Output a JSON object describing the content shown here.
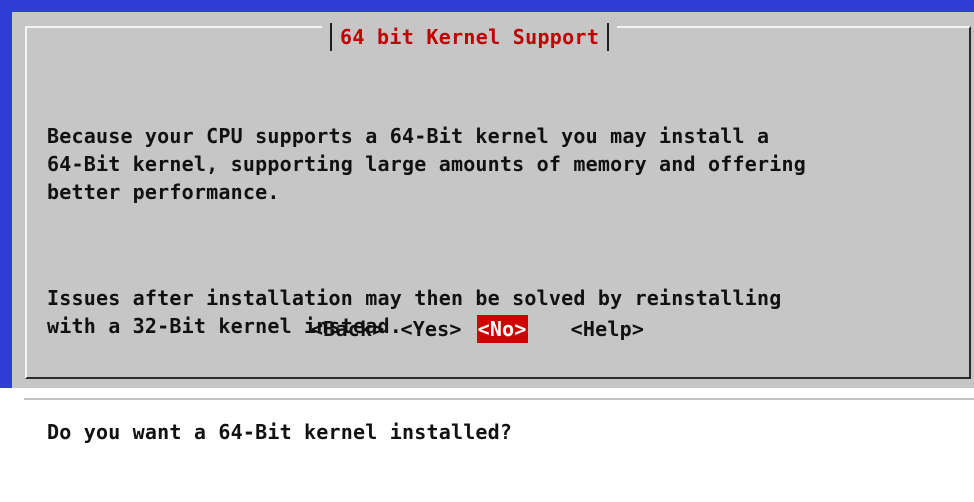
{
  "window": {
    "title": "64 bit Kernel Support"
  },
  "message": {
    "paragraph_1": "Because your CPU supports a 64-Bit kernel you may install a\n64-Bit kernel, supporting large amounts of memory and offering\nbetter performance.",
    "paragraph_2": "Issues after installation may then be solved by reinstalling\nwith a 32-Bit kernel instead.",
    "question": "Do you want a 64-Bit kernel installed?"
  },
  "buttons": {
    "back": "<Back>",
    "yes": "<Yes>",
    "no": "<No>",
    "help": "<Help>"
  },
  "colors": {
    "background_blue": "#2f3fd6",
    "dialog_gray": "#c6c6c6",
    "title_red": "#c00000",
    "selected_button_red": "#d10000"
  }
}
